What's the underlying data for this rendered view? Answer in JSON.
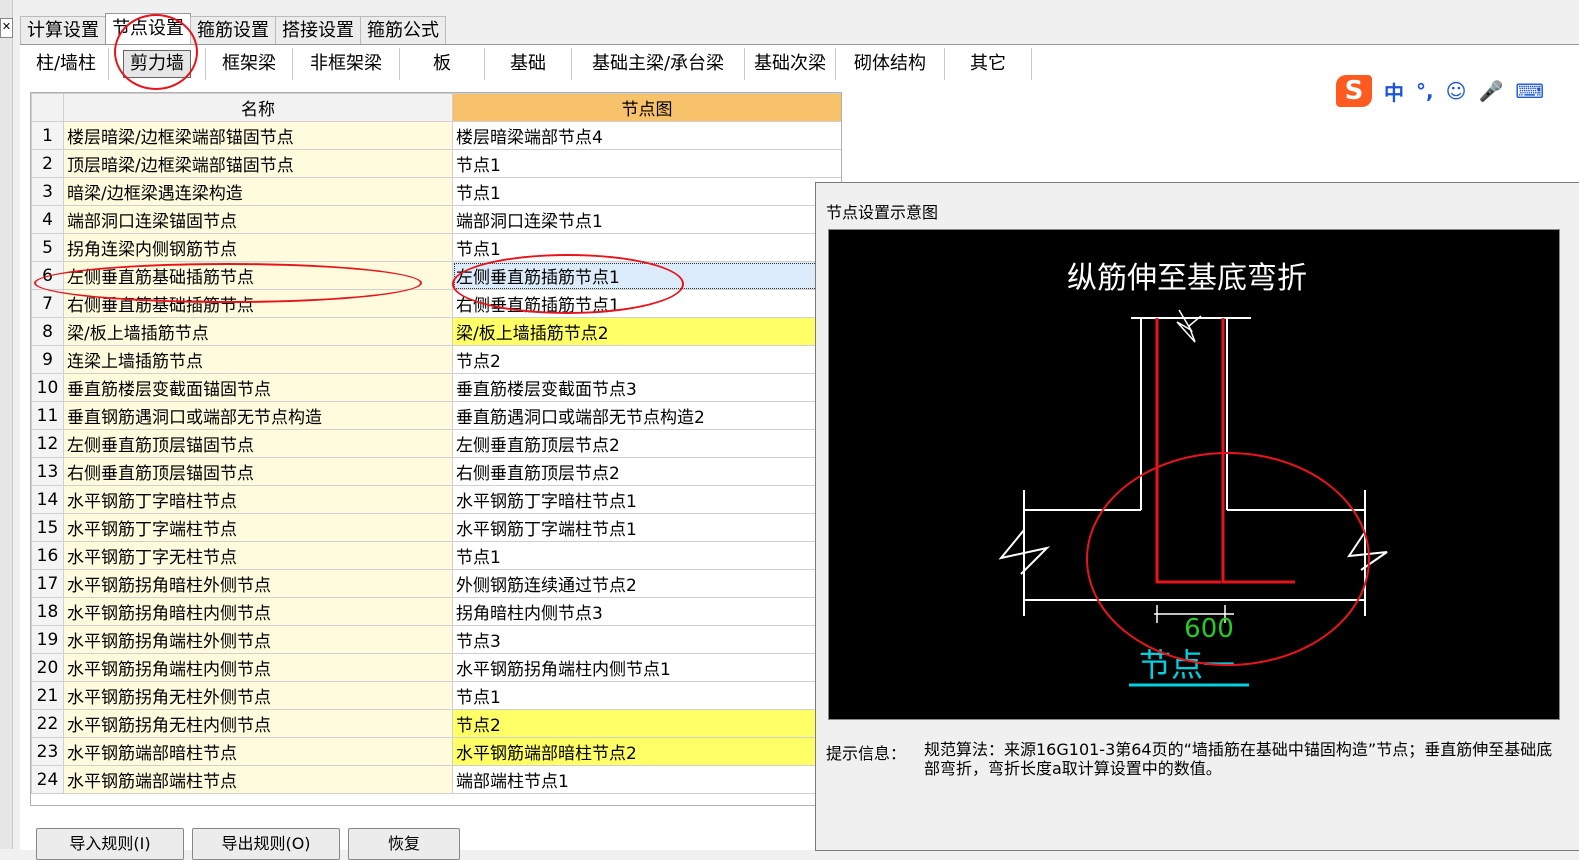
{
  "top_tabs": [
    "计算设置",
    "节点设置",
    "箍筋设置",
    "搭接设置",
    "箍筋公式"
  ],
  "top_tab_active": 1,
  "sub_tabs": [
    "柱/墙柱",
    "剪力墙",
    "框架梁",
    "非框架梁",
    "板",
    "基础",
    "基础主梁/承台梁",
    "基础次梁",
    "砌体结构",
    "其它"
  ],
  "sub_tab_active": 1,
  "grid": {
    "col_name": "名称",
    "col_value": "节点图",
    "rows": [
      {
        "n": "1",
        "name": "楼层暗梁/边框梁端部锚固节点",
        "value": "楼层暗梁端部节点4"
      },
      {
        "n": "2",
        "name": "顶层暗梁/边框梁端部锚固节点",
        "value": "节点1"
      },
      {
        "n": "3",
        "name": "暗梁/边框梁遇连梁构造",
        "value": "节点1"
      },
      {
        "n": "4",
        "name": "端部洞口连梁锚固节点",
        "value": "端部洞口连梁节点1"
      },
      {
        "n": "5",
        "name": "拐角连梁内侧钢筋节点",
        "value": "节点1"
      },
      {
        "n": "6",
        "name": "左侧垂直筋基础插筋节点",
        "value": "左侧垂直筋插筋节点1"
      },
      {
        "n": "7",
        "name": "右侧垂直筋基础插筋节点",
        "value": "右侧垂直筋插筋节点1"
      },
      {
        "n": "8",
        "name": "梁/板上墙插筋节点",
        "value": "梁/板上墙插筋节点2"
      },
      {
        "n": "9",
        "name": "连梁上墙插筋节点",
        "value": "节点2"
      },
      {
        "n": "10",
        "name": "垂直筋楼层变截面锚固节点",
        "value": "垂直筋楼层变截面节点3"
      },
      {
        "n": "11",
        "name": "垂直钢筋遇洞口或端部无节点构造",
        "value": "垂直筋遇洞口或端部无节点构造2"
      },
      {
        "n": "12",
        "name": "左侧垂直筋顶层锚固节点",
        "value": "左侧垂直筋顶层节点2"
      },
      {
        "n": "13",
        "name": "右侧垂直筋顶层锚固节点",
        "value": "右侧垂直筋顶层节点2"
      },
      {
        "n": "14",
        "name": "水平钢筋丁字暗柱节点",
        "value": "水平钢筋丁字暗柱节点1"
      },
      {
        "n": "15",
        "name": "水平钢筋丁字端柱节点",
        "value": "水平钢筋丁字端柱节点1"
      },
      {
        "n": "16",
        "name": "水平钢筋丁字无柱节点",
        "value": "节点1"
      },
      {
        "n": "17",
        "name": "水平钢筋拐角暗柱外侧节点",
        "value": "外侧钢筋连续通过节点2"
      },
      {
        "n": "18",
        "name": "水平钢筋拐角暗柱内侧节点",
        "value": "拐角暗柱内侧节点3"
      },
      {
        "n": "19",
        "name": "水平钢筋拐角端柱外侧节点",
        "value": "节点3"
      },
      {
        "n": "20",
        "name": "水平钢筋拐角端柱内侧节点",
        "value": "水平钢筋拐角端柱内侧节点1"
      },
      {
        "n": "21",
        "name": "水平钢筋拐角无柱外侧节点",
        "value": "节点1"
      },
      {
        "n": "22",
        "name": "水平钢筋拐角无柱内侧节点",
        "value": "节点2"
      },
      {
        "n": "23",
        "name": "水平钢筋端部暗柱节点",
        "value": "水平钢筋端部暗柱节点2"
      },
      {
        "n": "24",
        "name": "水平钢筋端部端柱节点",
        "value": "端部端柱节点1"
      }
    ],
    "selected_row": 5,
    "yellow_rows": [
      7,
      21,
      22
    ]
  },
  "ime": {
    "logo": "S",
    "items": [
      "中",
      "°,",
      "☺",
      "🎤",
      "⌨"
    ]
  },
  "panel": {
    "title": "节点设置示意图",
    "diagram_title": "纵筋伸至基底弯折",
    "dimension": "600",
    "node_label": "节点一",
    "hint_label": "提示信息：",
    "hint_text": "规范算法：来源16G101-3第64页的“墙插筋在基础中锚固构造”节点；垂直筋伸至基础底部弯折，弯折长度a取计算设置中的数值。"
  },
  "buttons": [
    "导入规则(I)",
    "导出规则(O)",
    "恢复"
  ],
  "colors": {
    "annotation": "#e8141c",
    "rebar": "#e8141c",
    "dimension": "#22cc22",
    "node_label": "#00d0e0",
    "header_highlight": "#f7c26a",
    "row_yellow": "#ffff66"
  }
}
